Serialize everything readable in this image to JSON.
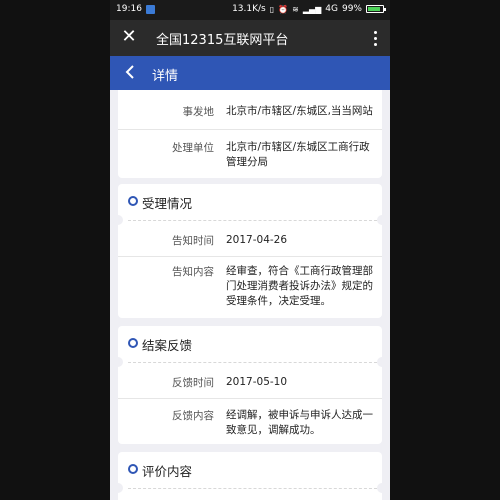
{
  "status_bar": {
    "time": "19:16",
    "network_speed": "13.1K/s",
    "network_type": "4G",
    "battery_percent": "99%",
    "battery_level": 0.99,
    "icons": [
      "app-notification-icon",
      "vibrate-icon",
      "alarm-icon",
      "wifi-icon",
      "signal-icon",
      "battery-icon"
    ]
  },
  "app_bar": {
    "title": "全国12315互联网平台"
  },
  "sub_bar": {
    "title": "详情"
  },
  "event": {
    "rows": [
      {
        "label": "事发地",
        "value": "北京市/市辖区/东城区,当当网站"
      },
      {
        "label": "处理单位",
        "value": "北京市/市辖区/东城区工商行政管理分局"
      }
    ]
  },
  "acceptance": {
    "title": "受理情况",
    "rows": [
      {
        "label": "告知时间",
        "value": "2017-04-26"
      },
      {
        "label": "告知内容",
        "value": "经审查，符合《工商行政管理部门处理消费者投诉办法》规定的受理条件，决定受理。"
      }
    ]
  },
  "closure": {
    "title": "结案反馈",
    "rows": [
      {
        "label": "反馈时间",
        "value": "2017-05-10"
      },
      {
        "label": "反馈内容",
        "value": "经调解，被申诉与申诉人达成一致意见，调解成功。"
      }
    ]
  },
  "evaluation": {
    "title": "评价内容"
  },
  "colors": {
    "app_bar": "#2b2b2b",
    "sub_bar": "#2f56b5",
    "accent_dot": "#2f56b5",
    "background": "#efeff4"
  }
}
